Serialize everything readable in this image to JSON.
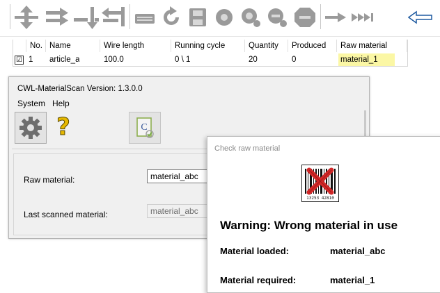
{
  "toolbar": {
    "icons": [
      "move-up-down-icon",
      "move-right-icon",
      "insert-down-icon",
      "swap-icon",
      "keyboard-icon",
      "rotate-icon",
      "save-icon",
      "circle-icon",
      "zoom-icon",
      "zoom-alt-icon",
      "stop-icon",
      "arrow-right-icon",
      "fast-forward-icon",
      "back-arrow-icon"
    ]
  },
  "grid": {
    "columns": [
      "No.",
      "Name",
      "Wire length",
      "Running cycle",
      "Quantity",
      "Produced",
      "Raw material"
    ],
    "rows": [
      {
        "checked": "☑",
        "no": "1",
        "name": "article_a",
        "wire_length": "100.0",
        "running_cycle": "0 \\ 1",
        "quantity": "20",
        "produced": "0",
        "raw_material": "material_1"
      }
    ]
  },
  "main_window": {
    "title": "CWL-MaterialScan  Version: 1.3.0.0",
    "menu": [
      "System",
      "Help"
    ],
    "toolbar": [
      "gear-icon",
      "help-icon",
      "scan-sheet-icon"
    ],
    "help_glyph": "?",
    "scan_glyph": "C",
    "raw_material_label": "Raw material:",
    "raw_material_value": "material_abc",
    "last_scanned_label": "Last scanned material:",
    "last_scanned_value": "material_abc"
  },
  "dialog": {
    "title": "Check raw material",
    "barcode_number": "13253 42810",
    "warning": "Warning: Wrong material in use",
    "loaded_label": "Material loaded:",
    "loaded_value": "material_abc",
    "required_label": "Material required:",
    "required_value": "material_1"
  },
  "colors": {
    "raw_highlight": "#fbf7a5",
    "icon_gray": "#9a9a9a",
    "back_arrow": "#1e5aa0",
    "error_red": "#d22828"
  }
}
